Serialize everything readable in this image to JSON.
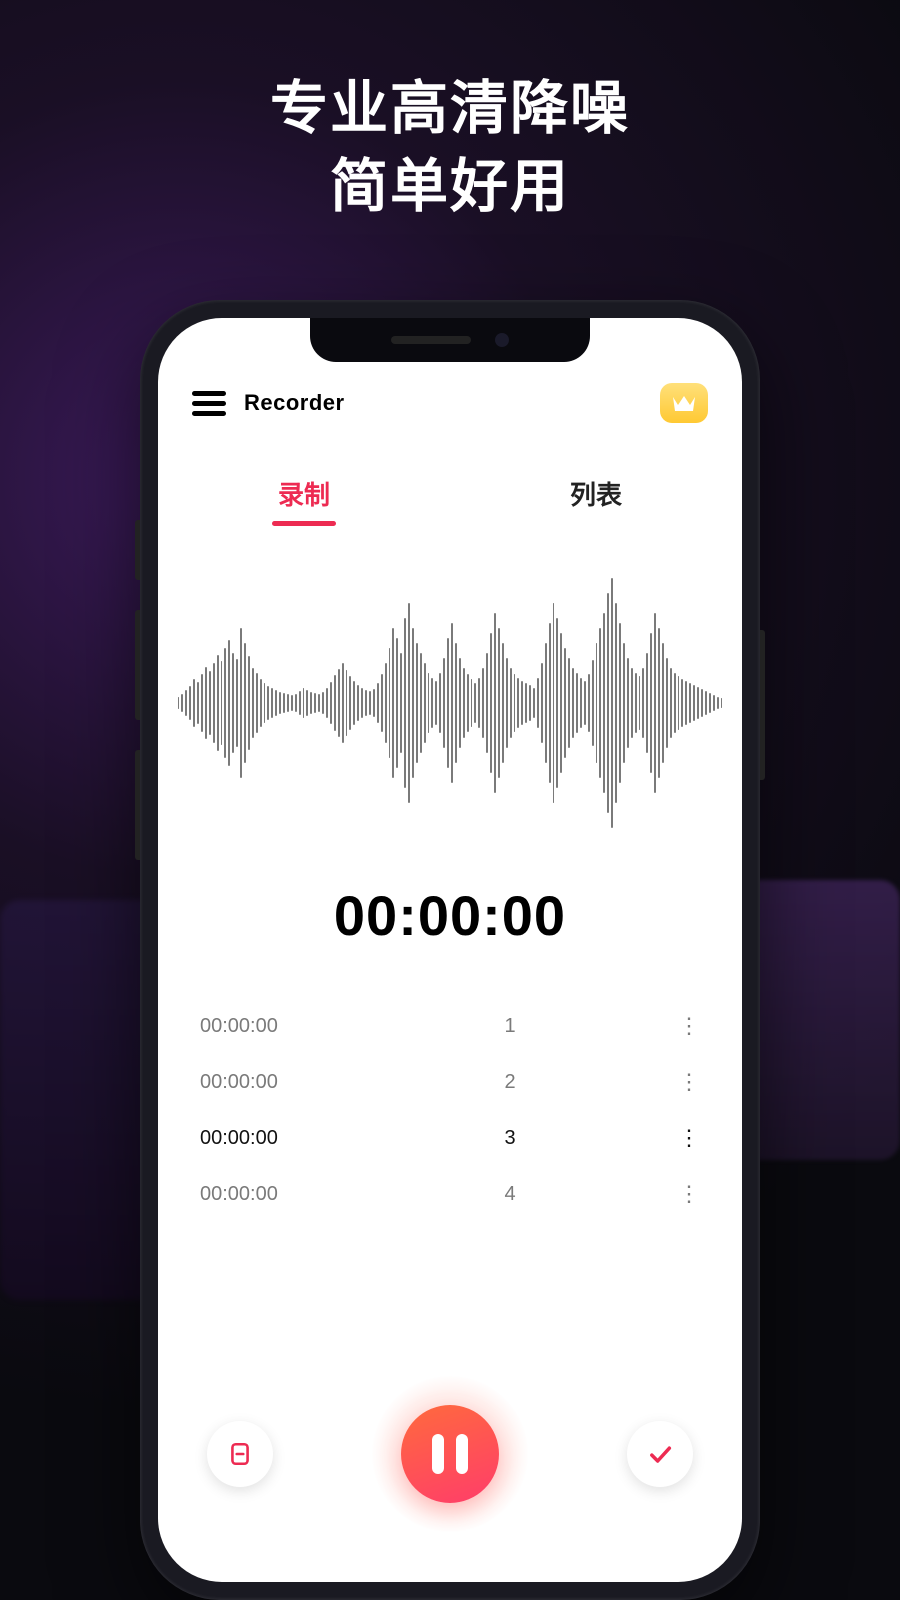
{
  "headline": {
    "line1": "专业高清降噪",
    "line2": "简单好用"
  },
  "header": {
    "title": "Recorder"
  },
  "tabs": {
    "record": "录制",
    "list": "列表",
    "active": "record"
  },
  "timer": "00:00:00",
  "markers": [
    {
      "time": "00:00:00",
      "index": "1",
      "strong": false
    },
    {
      "time": "00:00:00",
      "index": "2",
      "strong": false
    },
    {
      "time": "00:00:00",
      "index": "3",
      "strong": true
    },
    {
      "time": "00:00:00",
      "index": "4",
      "strong": false
    }
  ],
  "icons": {
    "menu": "menu-icon",
    "crown": "crown-icon",
    "bookmark": "bookmark-icon",
    "pause": "pause-icon",
    "check": "check-icon",
    "more": "more-icon"
  },
  "colors": {
    "accent": "#ed2b52",
    "recordGradientA": "#ff6a3d",
    "recordGradientB": "#ff3d6a",
    "crown": "#ffc933"
  },
  "waveform_heights": [
    12,
    18,
    26,
    34,
    48,
    42,
    58,
    72,
    64,
    80,
    96,
    84,
    110,
    126,
    100,
    88,
    150,
    120,
    94,
    70,
    60,
    48,
    40,
    34,
    30,
    26,
    22,
    20,
    18,
    16,
    18,
    24,
    30,
    26,
    22,
    20,
    18,
    22,
    30,
    42,
    56,
    68,
    80,
    66,
    54,
    44,
    36,
    30,
    26,
    24,
    28,
    40,
    58,
    80,
    110,
    150,
    130,
    100,
    170,
    200,
    150,
    120,
    100,
    80,
    60,
    50,
    44,
    60,
    90,
    130,
    160,
    120,
    90,
    70,
    58,
    48,
    40,
    50,
    70,
    100,
    140,
    180,
    150,
    120,
    90,
    70,
    58,
    50,
    44,
    40,
    36,
    30,
    50,
    80,
    120,
    160,
    200,
    170,
    140,
    110,
    90,
    70,
    60,
    50,
    44,
    58,
    86,
    120,
    150,
    180,
    220,
    250,
    200,
    160,
    120,
    90,
    70,
    60,
    54,
    70,
    100,
    140,
    180,
    150,
    120,
    90,
    70,
    60,
    54,
    48,
    44,
    40,
    36,
    32,
    28,
    24,
    20,
    16,
    12,
    10
  ]
}
